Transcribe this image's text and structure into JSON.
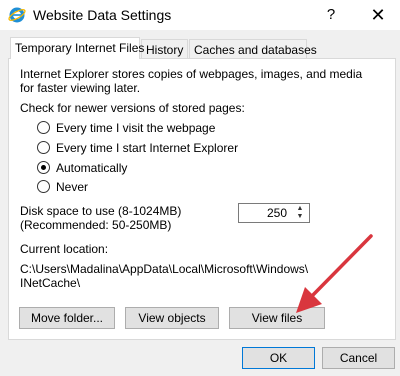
{
  "window": {
    "title": "Website Data Settings",
    "help_glyph": "?",
    "close_glyph": "✕"
  },
  "tabs": [
    {
      "label": "Temporary Internet Files",
      "active": true
    },
    {
      "label": "History",
      "active": false
    },
    {
      "label": "Caches and databases",
      "active": false
    }
  ],
  "temp_files": {
    "description_line1": "Internet Explorer stores copies of webpages, images, and media",
    "description_line2": "for faster viewing later.",
    "check_label": "Check for newer versions of stored pages:",
    "options": [
      {
        "label": "Every time I visit the webpage",
        "selected": false
      },
      {
        "label": "Every time I start Internet Explorer",
        "selected": false
      },
      {
        "label": "Automatically",
        "selected": true
      },
      {
        "label": "Never",
        "selected": false
      }
    ],
    "disk_label_line1": "Disk space to use (8-1024MB)",
    "disk_label_line2": "(Recommended: 50-250MB)",
    "disk_value": "250",
    "location_label": "Current location:",
    "location_line1": "C:\\Users\\Madalina\\AppData\\Local\\Microsoft\\Windows\\",
    "location_line2": "INetCache\\",
    "buttons": {
      "move_folder": "Move folder...",
      "view_objects": "View objects",
      "view_files": "View files"
    }
  },
  "footer": {
    "ok": "OK",
    "cancel": "Cancel"
  },
  "colors": {
    "arrow": "#d9363e",
    "default_button_border": "#0078d7",
    "ie_icon": "#1e8fd6"
  }
}
